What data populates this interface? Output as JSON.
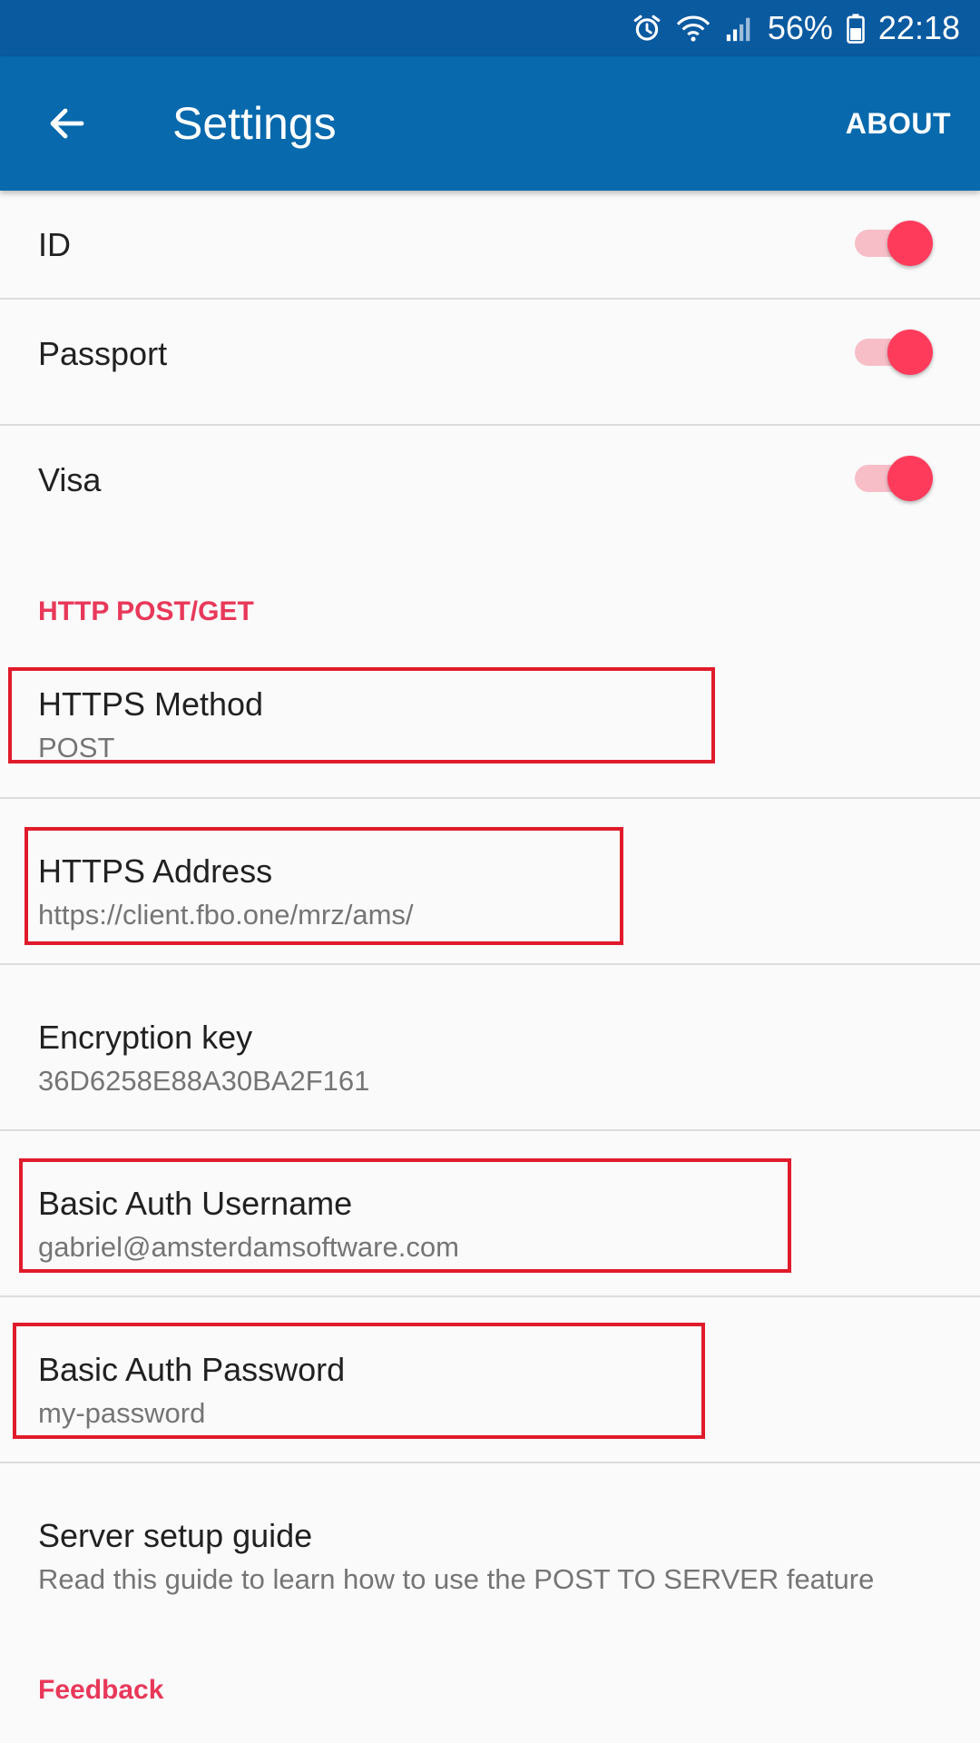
{
  "status_bar": {
    "battery_percent": "56%",
    "time": "22:18",
    "icons": [
      "alarm-icon",
      "wifi-icon",
      "signal-icon",
      "battery-icon"
    ]
  },
  "app_bar": {
    "title": "Settings",
    "about_label": "ABOUT",
    "back_icon": "arrow-left-icon"
  },
  "toggles": [
    {
      "label": "ID",
      "enabled": true
    },
    {
      "label": "Passport",
      "enabled": true
    },
    {
      "label": "Visa",
      "enabled": true
    }
  ],
  "section_http": {
    "header": "HTTP POST/GET"
  },
  "preferences": [
    {
      "title": "HTTPS Method",
      "summary": "POST"
    },
    {
      "title": "HTTPS Address",
      "summary": "https://client.fbo.one/mrz/ams/"
    },
    {
      "title": "Encryption key",
      "summary": "36D6258E88A30BA2F161"
    },
    {
      "title": "Basic Auth Username",
      "summary": "gabriel@amsterdamsoftware.com"
    },
    {
      "title": "Basic Auth Password",
      "summary": "my-password"
    },
    {
      "title": "Server setup guide",
      "summary": "Read this guide to learn how to use the POST TO SERVER feature"
    }
  ],
  "section_feedback": {
    "header": "Feedback"
  },
  "colors": {
    "status_bar": "#0a5aa0",
    "app_bar": "#0869ad",
    "accent": "#ff3b5c",
    "section_header": "#e8385a",
    "highlight_border": "#e01b2b"
  }
}
